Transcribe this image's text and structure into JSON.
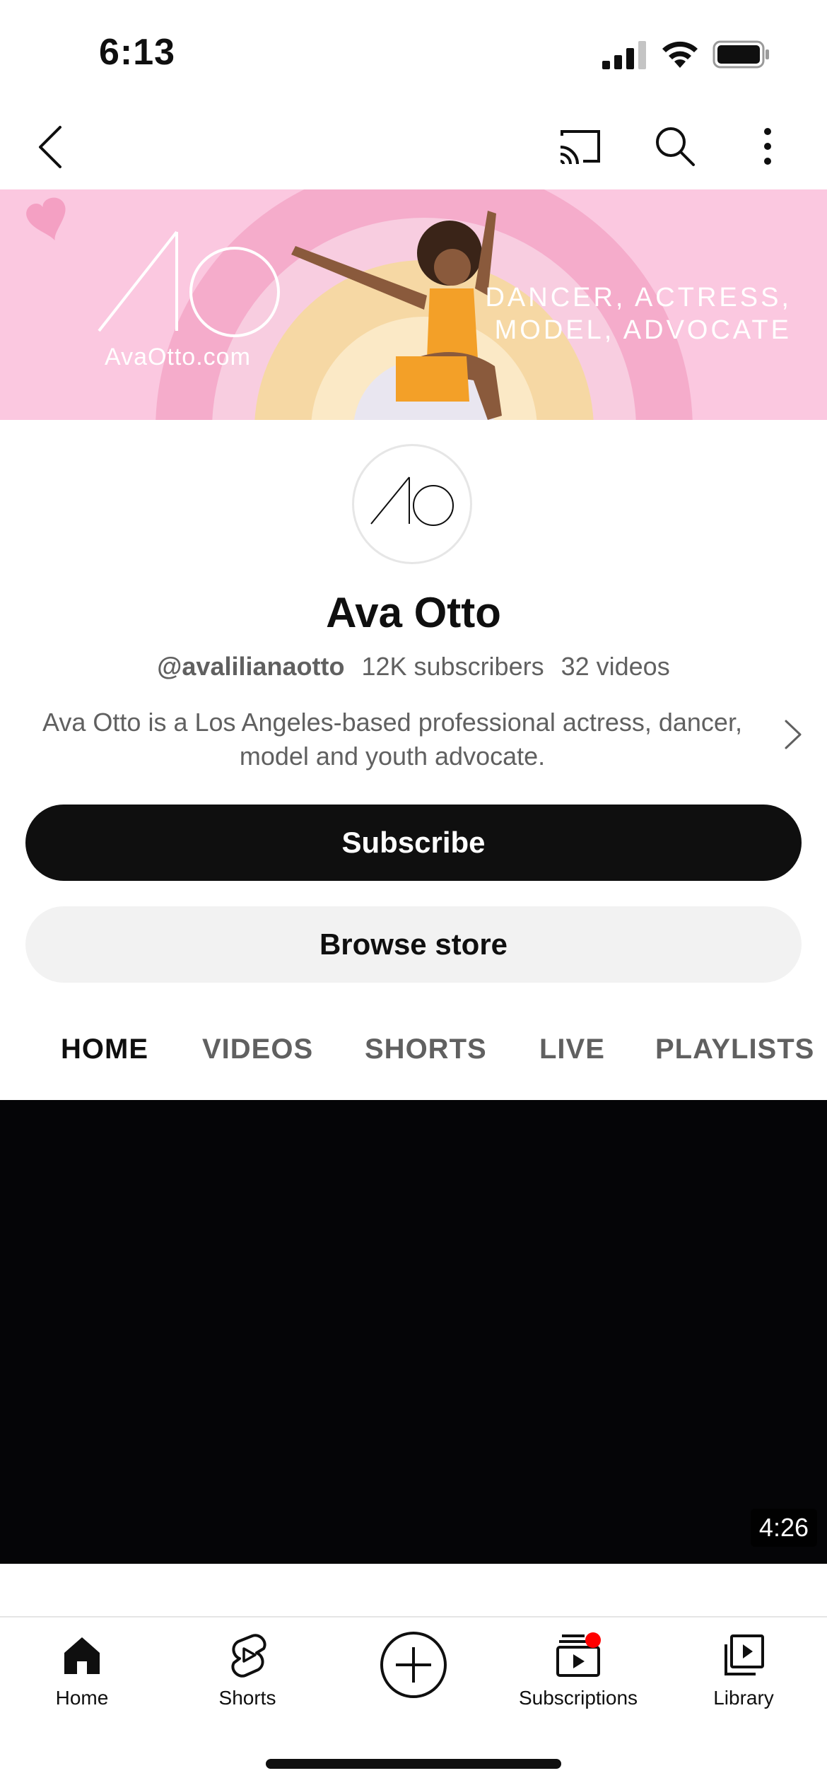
{
  "status_bar": {
    "time": "6:13"
  },
  "top_bar": {
    "back_icon": "chevron-left-icon",
    "cast_icon": "cast-icon",
    "search_icon": "search-icon",
    "more_icon": "more-vertical-icon"
  },
  "banner": {
    "url": "AvaOtto.com",
    "tagline_line1": "DANCER, ACTRESS,",
    "tagline_line2": "MODEL, ADVOCATE",
    "colors": {
      "background": "#f9c2dc",
      "arch_outer": "#f2a3c4",
      "arch_inner": "#f6d9a6"
    }
  },
  "channel": {
    "name": "Ava Otto",
    "handle": "@avalilianaotto",
    "subscribers": "12K subscribers",
    "videos": "32 videos",
    "description": "Ava Otto is a Los Angeles-based professional actress, dancer, model and youth advocate."
  },
  "actions": {
    "subscribe_label": "Subscribe",
    "store_label": "Browse store"
  },
  "tabs": [
    {
      "label": "HOME",
      "active": true
    },
    {
      "label": "VIDEOS",
      "active": false
    },
    {
      "label": "SHORTS",
      "active": false
    },
    {
      "label": "LIVE",
      "active": false
    },
    {
      "label": "PLAYLISTS",
      "active": false
    }
  ],
  "video": {
    "duration": "4:26"
  },
  "bottom_nav": {
    "items": [
      {
        "label": "Home",
        "icon": "home-icon"
      },
      {
        "label": "Shorts",
        "icon": "shorts-icon"
      },
      {
        "label": "",
        "icon": "create-plus-icon"
      },
      {
        "label": "Subscriptions",
        "icon": "subscriptions-icon"
      },
      {
        "label": "Library",
        "icon": "library-icon"
      }
    ],
    "notification_color": "#ff0000"
  }
}
